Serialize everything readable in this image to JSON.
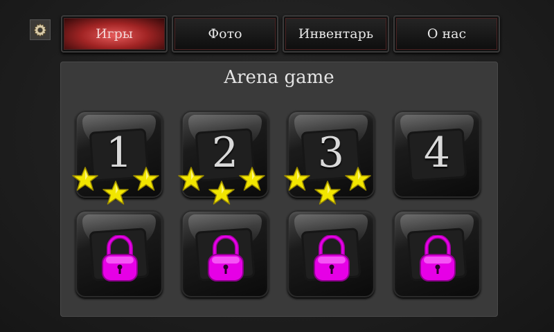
{
  "settings_icon": "gear-icon",
  "tabs": [
    {
      "label": "Игры",
      "active": true
    },
    {
      "label": "Фото",
      "active": false
    },
    {
      "label": "Инвентарь",
      "active": false
    },
    {
      "label": "О нас",
      "active": false
    }
  ],
  "panel": {
    "title": "Arena game"
  },
  "levels": [
    {
      "number": "1",
      "stars": 3,
      "locked": false
    },
    {
      "number": "2",
      "stars": 3,
      "locked": false
    },
    {
      "number": "3",
      "stars": 3,
      "locked": false
    },
    {
      "number": "4",
      "stars": 0,
      "locked": false
    },
    {
      "locked": true,
      "icon": "padlock-icon"
    },
    {
      "locked": true,
      "icon": "padlock-icon"
    },
    {
      "locked": true,
      "icon": "padlock-icon"
    },
    {
      "locked": true,
      "icon": "padlock-icon"
    }
  ],
  "colors": {
    "active_tab": "#c43333",
    "star": "#f2e600",
    "lock": "#e600e6"
  }
}
